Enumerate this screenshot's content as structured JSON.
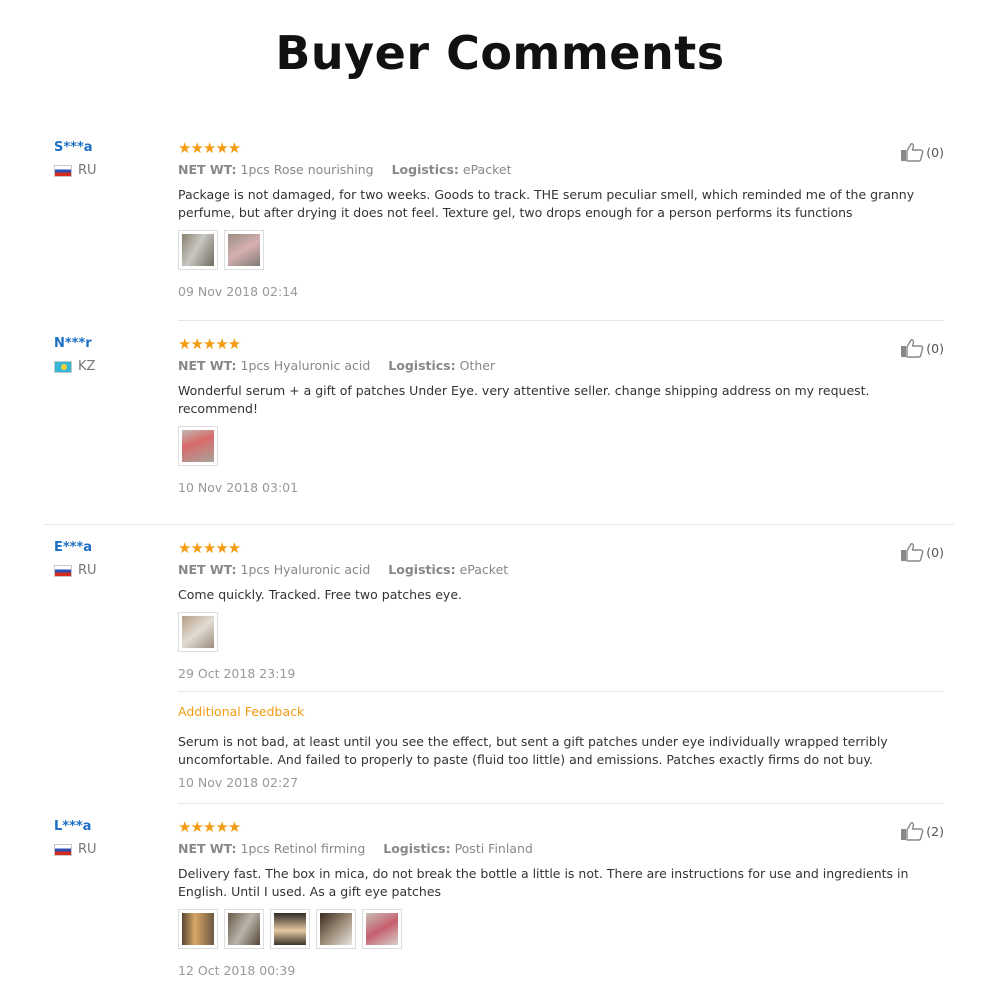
{
  "page": {
    "title": "Buyer Comments"
  },
  "labels": {
    "net_wt": "NET WT:",
    "logistics": "Logistics:",
    "additional_feedback": "Additional Feedback"
  },
  "colors": {
    "star": "#f39b12",
    "username": "#1d6fc5",
    "feedback_label": "#f39b12"
  },
  "reviews": [
    {
      "user": "S***a",
      "country": "RU",
      "stars": "★★★★★",
      "net_wt": "1pcs Rose nourishing",
      "logistics": "ePacket",
      "text": "Package is not damaged, for two weeks. Goods to track. THE serum peculiar smell, which reminded me of the granny perfume, but after drying it does not feel. Texture gel, two drops enough for a person performs its functions",
      "photo_count": 2,
      "date": "09 Nov 2018 02:14",
      "helpful": "(0)"
    },
    {
      "user": "N***r",
      "country": "KZ",
      "stars": "★★★★★",
      "net_wt": "1pcs Hyaluronic acid",
      "logistics": "Other",
      "text": "Wonderful serum + a gift of patches Under Eye. very attentive seller. change shipping address on my request. recommend!",
      "photo_count": 1,
      "date": "10 Nov 2018 03:01",
      "helpful": "(0)"
    },
    {
      "user": "E***a",
      "country": "RU",
      "stars": "★★★★★",
      "net_wt": "1pcs Hyaluronic acid",
      "logistics": "ePacket",
      "text": "Come quickly. Tracked. Free two patches eye.",
      "photo_count": 1,
      "date": "29 Oct 2018 23:19",
      "helpful": "(0)",
      "additional": {
        "text": "Serum is not bad, at least until you see the effect, but sent a gift patches under eye individually wrapped terribly uncomfortable. And failed to properly to paste (fluid too little) and emissions. Patches exactly firms do not buy.",
        "date": "10 Nov 2018 02:27"
      }
    },
    {
      "user": "L***a",
      "country": "RU",
      "stars": "★★★★★",
      "net_wt": "1pcs Retinol firming",
      "logistics": "Posti Finland",
      "text": "Delivery fast. The box in mica, do not break the bottle a little is not. There are instructions for use and ingredients in English. Until I used. As a gift eye patches",
      "photo_count": 5,
      "date": "12 Oct 2018 00:39",
      "helpful": "(2)"
    }
  ]
}
